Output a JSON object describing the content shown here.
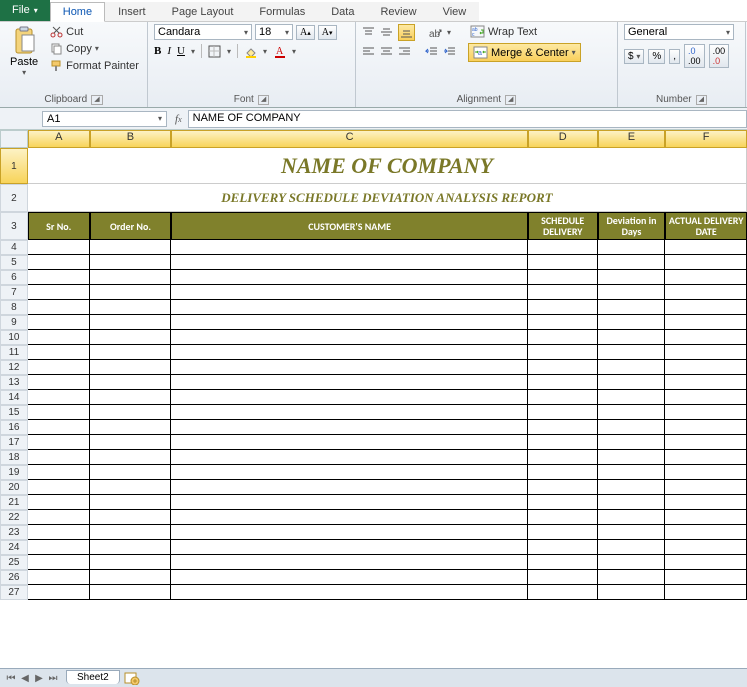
{
  "tabs": {
    "file": "File",
    "items": [
      "Home",
      "Insert",
      "Page Layout",
      "Formulas",
      "Data",
      "Review",
      "View"
    ],
    "active": "Home"
  },
  "ribbon": {
    "clipboard": {
      "paste": "Paste",
      "cut": "Cut",
      "copy": "Copy",
      "fmtpainter": "Format Painter",
      "label": "Clipboard"
    },
    "font": {
      "name": "Candara",
      "size": "18",
      "label": "Font"
    },
    "alignment": {
      "wrap": "Wrap Text",
      "merge": "Merge & Center",
      "label": "Alignment"
    },
    "number": {
      "fmt": "General",
      "dollar": "$",
      "pct": "%",
      "comma": ",",
      "label": "Number"
    }
  },
  "formula_bar": {
    "namebox": "A1",
    "content": "NAME OF COMPANY"
  },
  "columns": [
    "A",
    "B",
    "C",
    "D",
    "E",
    "F"
  ],
  "row_numbers": [
    1,
    2,
    3,
    4,
    5,
    6,
    7,
    8,
    9,
    10,
    11,
    12,
    13,
    14,
    15,
    16,
    17,
    18,
    19,
    20,
    21,
    22,
    23,
    24,
    25,
    26,
    27
  ],
  "sheet": {
    "title": "NAME OF COMPANY",
    "subtitle": "DELIVERY SCHEDULE DEVIATION ANALYSIS REPORT",
    "headers": {
      "A": "Sr No.",
      "B": "Order No.",
      "C": "CUSTOMER'S NAME",
      "D": "SCHEDULE DELIVERY",
      "E": "Deviation in Days",
      "F": "ACTUAL DELIVERY DATE"
    }
  },
  "sheet_tabs": {
    "active": "Sheet2"
  },
  "chart_data": {
    "type": "table",
    "title": "DELIVERY SCHEDULE DEVIATION ANALYSIS REPORT",
    "columns": [
      "Sr No.",
      "Order No.",
      "CUSTOMER'S NAME",
      "SCHEDULE DELIVERY",
      "Deviation in Days",
      "ACTUAL DELIVERY DATE"
    ],
    "rows": []
  }
}
